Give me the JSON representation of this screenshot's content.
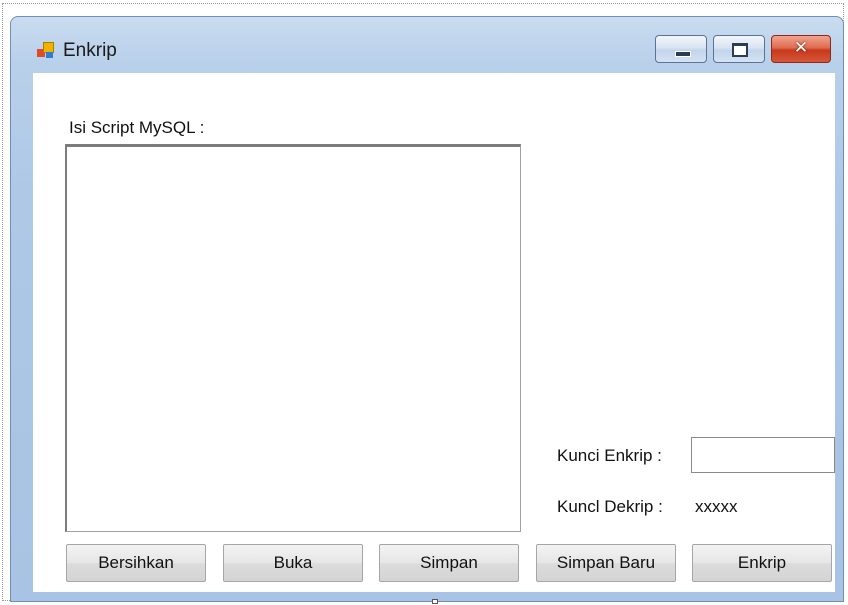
{
  "window": {
    "title": "Enkrip",
    "icon": "app-form-icon",
    "controls": {
      "minimize_icon": "minimize-icon",
      "maximize_icon": "maximize-icon",
      "close_icon": "close-icon",
      "close_glyph": "✕"
    }
  },
  "form": {
    "script_label": "Isi Script MySQL :",
    "script_value": "",
    "kunci_enkrip_label": "Kunci Enkrip :",
    "kunci_enkrip_value": "",
    "kunci_dekrip_label": "Kuncl Dekrip :",
    "kunci_dekrip_value": "xxxxx"
  },
  "buttons": {
    "bersihkan": "Bersihkan",
    "buka": "Buka",
    "simpan": "Simpan",
    "simpan_baru": "Simpan Baru",
    "enkrip": "Enkrip"
  },
  "colors": {
    "title_bar": "#aec8e6",
    "close_button": "#c7391c"
  }
}
